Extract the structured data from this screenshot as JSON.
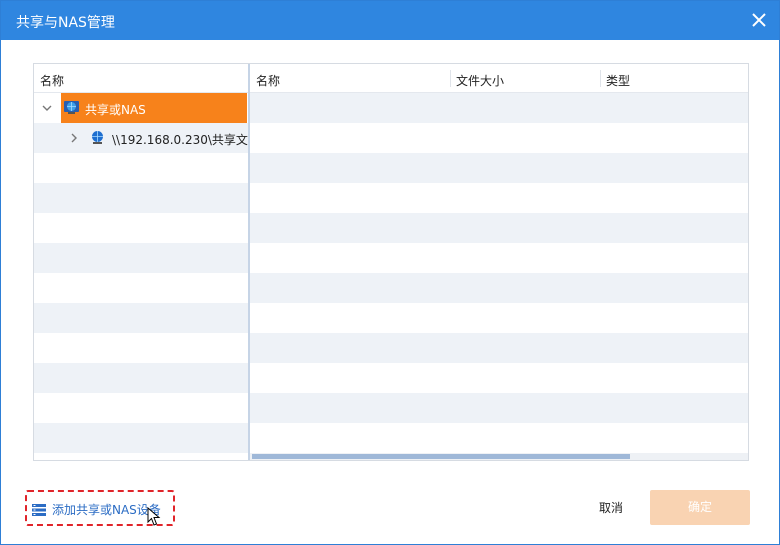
{
  "window": {
    "title": "共享与NAS管理",
    "colors": {
      "titlebar": "#2f86e0",
      "selection": "#f7821b",
      "link": "#2b6cc4",
      "disabled_button": "#f9d3b2"
    }
  },
  "left_panel": {
    "header": "名称",
    "tree": [
      {
        "label": "共享或NAS",
        "icon": "globe-icon",
        "expanded": true,
        "selected": true
      },
      {
        "label": "\\\\192.168.0.230\\共享文",
        "icon": "globe-icon",
        "expanded": false,
        "selected": false
      }
    ]
  },
  "right_panel": {
    "columns": [
      "名称",
      "文件大小",
      "类型"
    ],
    "rows": []
  },
  "footer": {
    "add_link": "添加共享或NAS设备",
    "cancel": "取消",
    "ok": "确定"
  }
}
